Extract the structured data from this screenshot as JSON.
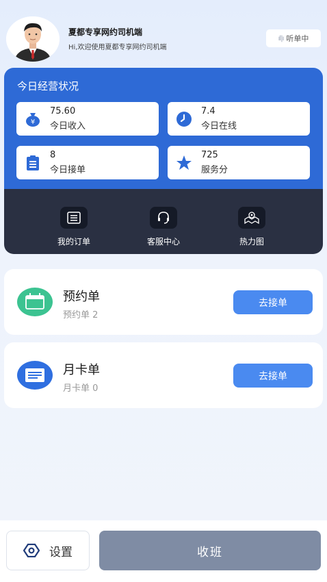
{
  "header": {
    "title": "夏都专享网约司机端",
    "subtitle": "Hi,欢迎使用夏都专享网约司机端",
    "listen_label": "听单中"
  },
  "stats": {
    "title": "今日经营状况",
    "tiles": [
      {
        "value": "75.60",
        "label": "今日收入",
        "icon": "money-bag-icon"
      },
      {
        "value": "7.4",
        "label": "今日在线",
        "icon": "clock-icon"
      },
      {
        "value": "8",
        "label": "今日接单",
        "icon": "clipboard-icon"
      },
      {
        "value": "725",
        "label": "服务分",
        "icon": "star-icon"
      }
    ]
  },
  "shortcuts": [
    {
      "label": "我的订单",
      "icon": "order-icon"
    },
    {
      "label": "客服中心",
      "icon": "headset-icon"
    },
    {
      "label": "热力图",
      "icon": "map-icon"
    }
  ],
  "orders": [
    {
      "title": "预约单",
      "count": "预约单 2",
      "button": "去接单",
      "icon": "calendar-icon"
    },
    {
      "title": "月卡单",
      "count": "月卡单 0",
      "button": "去接单",
      "icon": "card-icon"
    }
  ],
  "footer": {
    "settings_label": "设置",
    "offduty_label": "收班"
  },
  "colors": {
    "primary_blue": "#2e6ad6",
    "dark_panel": "#2a3042",
    "button_blue": "#4a8af0",
    "offduty_gray": "#7f8ca4",
    "green_icon": "#3cc391"
  }
}
